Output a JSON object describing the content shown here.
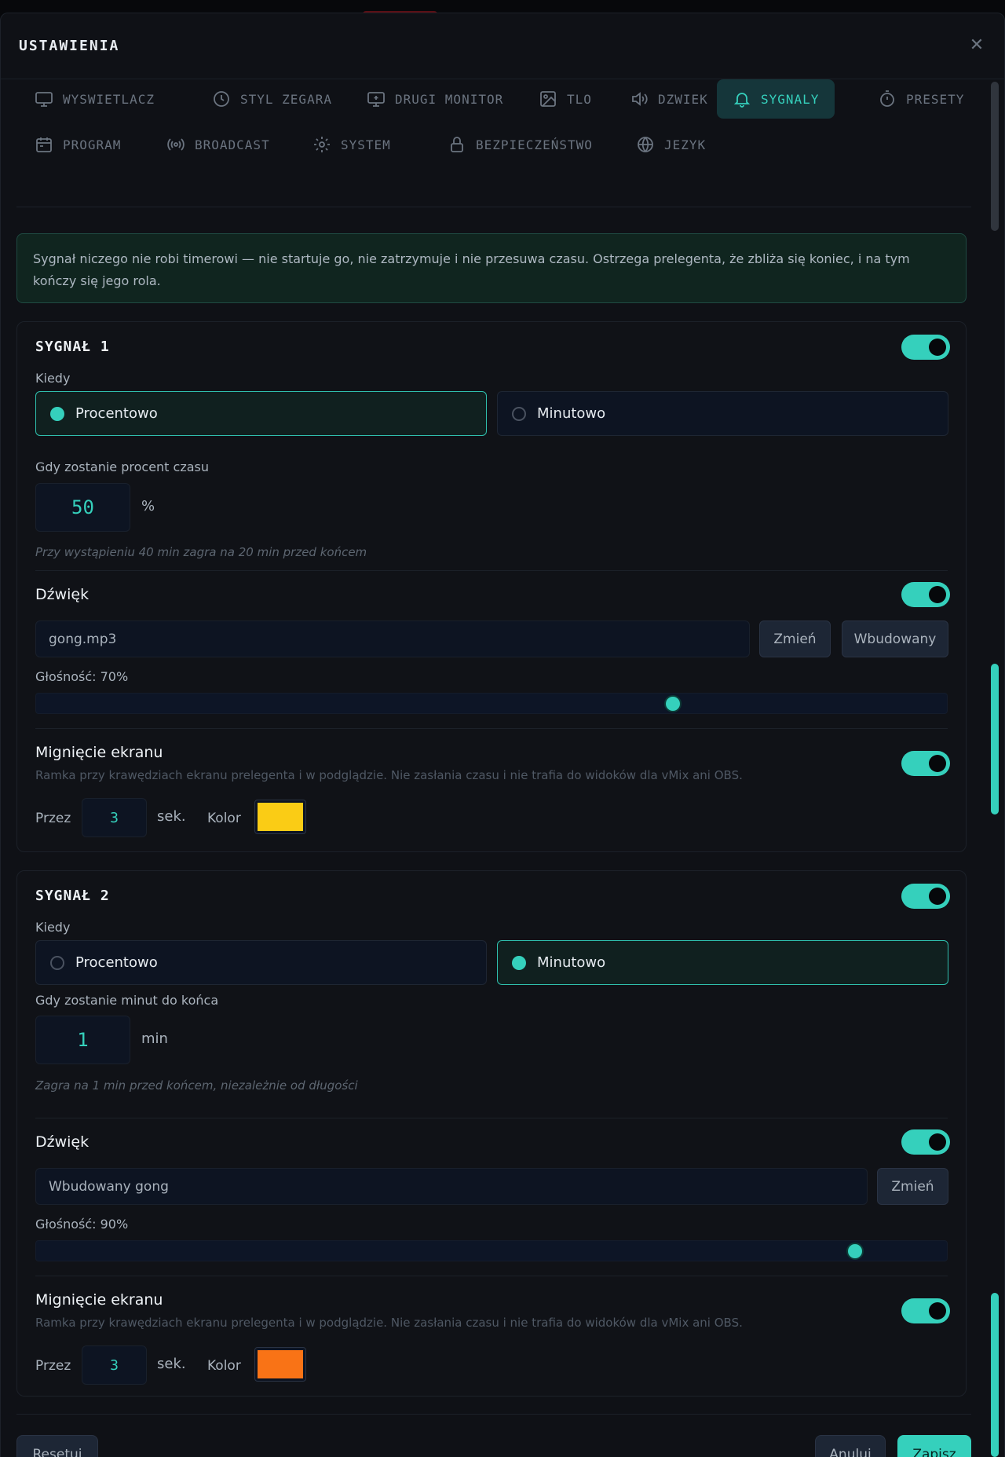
{
  "header": {
    "title": "USTAWIENIA",
    "close_icon": "close-icon"
  },
  "tabs": [
    {
      "label": "WYSWIETLACZ",
      "icon": "monitor-icon",
      "active": false
    },
    {
      "label": "STYL ZEGARA",
      "icon": "clock-icon",
      "active": false
    },
    {
      "label": "DRUGI MONITOR",
      "icon": "monitor-plus-icon",
      "active": false
    },
    {
      "label": "TLO",
      "icon": "image-icon",
      "active": false
    },
    {
      "label": "DZWIEK",
      "icon": "speaker-icon",
      "active": false
    },
    {
      "label": "SYGNALY",
      "icon": "bell-icon",
      "active": true
    },
    {
      "label": "PRESETY",
      "icon": "timer-icon",
      "active": false
    },
    {
      "label": "PROGRAM",
      "icon": "calendar-icon",
      "active": false
    },
    {
      "label": "BROADCAST",
      "icon": "broadcast-icon",
      "active": false
    },
    {
      "label": "SYSTEM",
      "icon": "gear-icon",
      "active": false
    },
    {
      "label": "BEZPIECZEŃSTWO",
      "icon": "lock-icon",
      "active": false
    },
    {
      "label": "JEZYK",
      "icon": "globe-icon",
      "active": false
    }
  ],
  "info": "Sygnał niczego nie robi timerowi — nie startuje go, nie zatrzymuje i nie przesuwa czasu. Ostrzega prelegenta, że zbliża się koniec, i na tym kończy się jego rola.",
  "signals": [
    {
      "title": "SYGNAŁ 1",
      "enabled": true,
      "when_label": "Kiedy",
      "mode_options": [
        "Procentowo",
        "Minutowo"
      ],
      "selected_mode": "Procentowo",
      "threshold_label": "Gdy zostanie procent czasu",
      "threshold_value": "50",
      "threshold_unit": "%",
      "hint": "Przy wystąpieniu 40 min zagra na 20 min przed końcem",
      "sound": {
        "title": "Dźwięk",
        "enabled": true,
        "file": "gong.mp3",
        "change_label": "Zmień",
        "builtin_label": "Wbudowany",
        "volume_label": "Głośność: 70%",
        "volume": 0.7
      },
      "flash": {
        "title": "Mignięcie ekranu",
        "enabled": true,
        "description": "Ramka przy krawędziach ekranu prelegenta i w podglądzie. Nie zasłania czasu i nie trafia do widoków dla vMix ani OBS.",
        "duration_label": "Przez",
        "duration_value": "3",
        "duration_unit": "sek.",
        "color_label": "Kolor",
        "color": "#facc15"
      }
    },
    {
      "title": "SYGNAŁ 2",
      "enabled": true,
      "when_label": "Kiedy",
      "mode_options": [
        "Procentowo",
        "Minutowo"
      ],
      "selected_mode": "Minutowo",
      "threshold_label": "Gdy zostanie minut do końca",
      "threshold_value": "1",
      "threshold_unit": "min",
      "hint": "Zagra na 1 min przed końcem, niezależnie od długości",
      "sound": {
        "title": "Dźwięk",
        "enabled": true,
        "file": "Wbudowany gong",
        "change_label": "Zmień",
        "volume_label": "Głośność: 90%",
        "volume": 0.9
      },
      "flash": {
        "title": "Mignięcie ekranu",
        "enabled": true,
        "description": "Ramka przy krawędziach ekranu prelegenta i w podglądzie. Nie zasłania czasu i nie trafia do widoków dla vMix ani OBS.",
        "duration_label": "Przez",
        "duration_value": "3",
        "duration_unit": "sek.",
        "color_label": "Kolor",
        "color": "#f97316"
      }
    }
  ],
  "footer": {
    "reset_label": "Resetuj",
    "cancel_label": "Anuluj",
    "save_label": "Zapisz"
  },
  "colors": {
    "accent": "#35d0bc",
    "background": "#0f1116",
    "panel": "#0d1422"
  }
}
